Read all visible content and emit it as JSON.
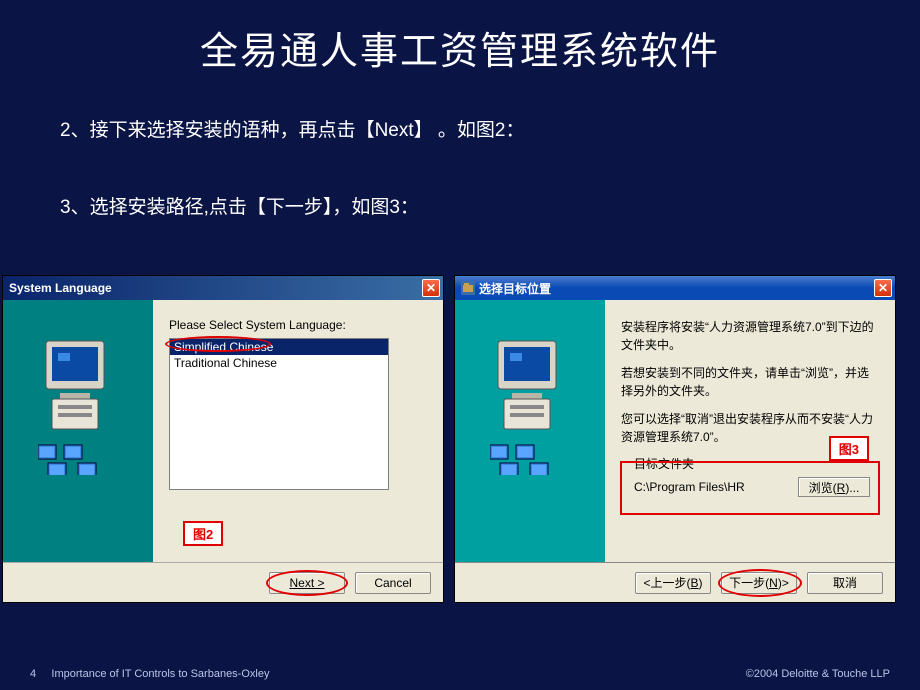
{
  "slide": {
    "title": "全易通人事工资管理系统软件",
    "step2": "2、接下来选择安装的语种，再点击【Next】 。如图2：",
    "step3": "3、选择安装路径,点击【下一步】，如图3："
  },
  "dialog1": {
    "title": "System Language",
    "prompt": "Please Select System Language:",
    "options": [
      "Simplified Chinese",
      "Traditional Chinese"
    ],
    "selected": 0,
    "fig_label": "图2",
    "next_btn": "Next >",
    "cancel_btn": "Cancel"
  },
  "dialog2": {
    "title": "选择目标位置",
    "line1": "安装程序将安装“人力资源管理系统7.0”到下边的文件夹中。",
    "line2": "若想安装到不同的文件夹，请单击“浏览”，并选择另外的文件夹。",
    "line3": "您可以选择“取消”退出安装程序从而不安装“人力资源管理系统7.0”。",
    "fig_label": "图3",
    "dest_label": "目标文件夹",
    "dest_path": "C:\\Program Files\\HR",
    "browse_btn": "浏览(R)...",
    "back_btn": "<上一步(B)",
    "next_btn": "下一步(N)>",
    "cancel_btn": "取消"
  },
  "footer": {
    "page": "4",
    "left": "Importance of IT Controls to Sarbanes-Oxley",
    "right": "©2004 Deloitte & Touche LLP"
  }
}
